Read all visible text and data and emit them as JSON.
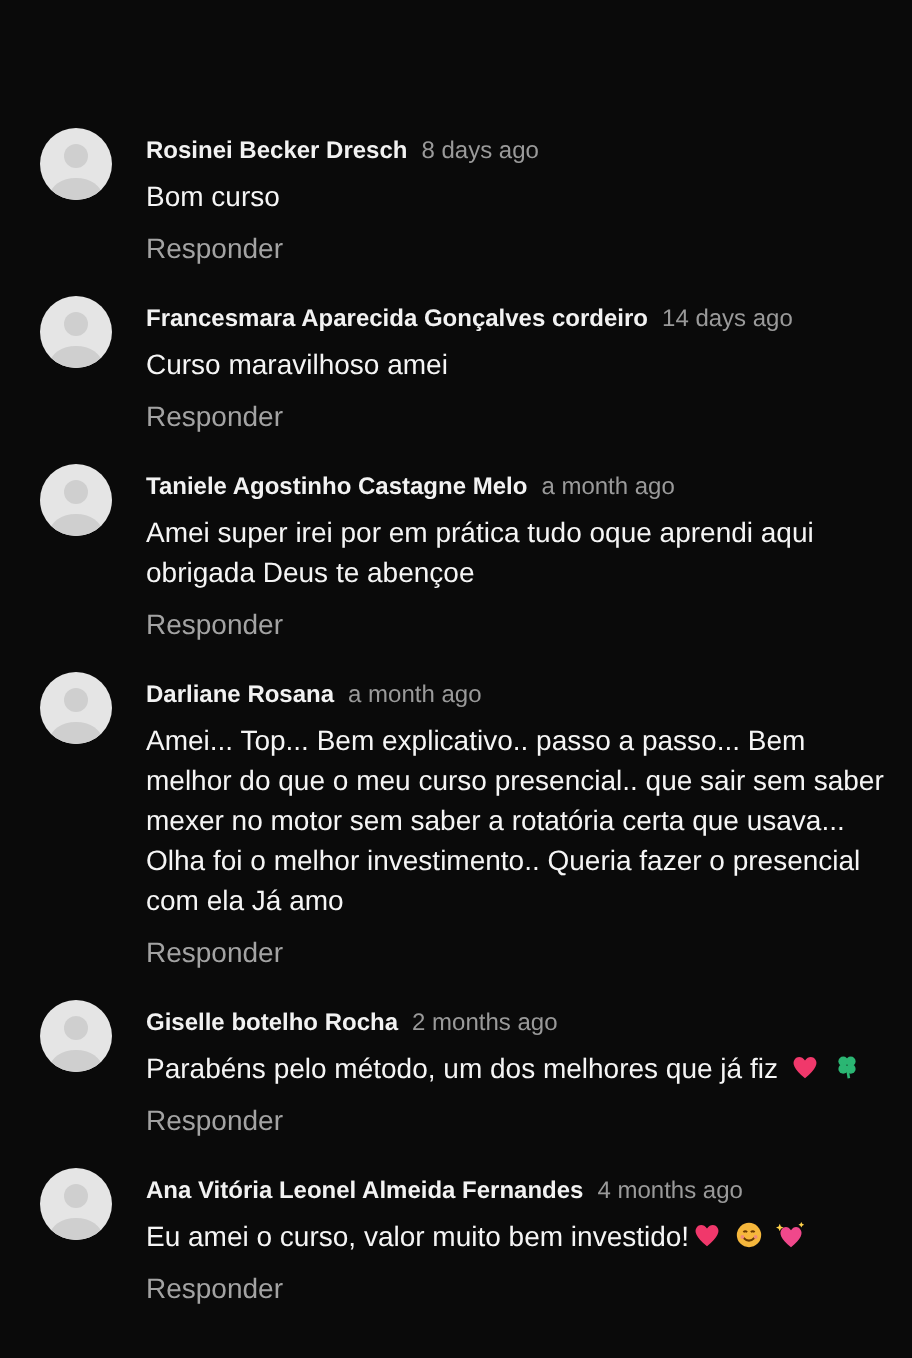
{
  "comments": [
    {
      "author": "Rosinei Becker Dresch",
      "time": "8 days ago",
      "text": "Bom curso",
      "reply": "Responder"
    },
    {
      "author": "Francesmara Aparecida Gonçalves cordeiro",
      "time": "14 days ago",
      "text": "Curso maravilhoso amei",
      "reply": "Responder"
    },
    {
      "author": "Taniele Agostinho Castagne Melo",
      "time": "a month ago",
      "text": "Amei super irei por em prática tudo oque aprendi aqui obrigada Deus te abençoe",
      "reply": "Responder"
    },
    {
      "author": "Darliane Rosana",
      "time": "a month ago",
      "text": "Amei... Top... Bem explicativo.. passo a passo... Bem melhor do que o meu curso presencial.. que sair sem saber mexer no motor sem saber a rotatória certa que usava... Olha foi o melhor investimento.. Queria fazer o presencial com ela Já amo",
      "reply": "Responder"
    },
    {
      "author": "Giselle botelho Rocha",
      "time": "2 months ago",
      "text": "Parabéns pelo método, um dos melhores que já fiz",
      "icons": [
        {
          "kind": "heart"
        },
        {
          "kind": "clover"
        }
      ],
      "reply": "Responder"
    },
    {
      "author": "Ana Vitória Leonel Almeida Fernandes",
      "time": "4 months ago",
      "text": "Eu amei o curso, valor muito bem investido!",
      "icons": [
        {
          "kind": "heart"
        },
        {
          "kind": "smile"
        },
        {
          "kind": "sparkle-heart"
        }
      ],
      "reply": "Responder"
    }
  ]
}
